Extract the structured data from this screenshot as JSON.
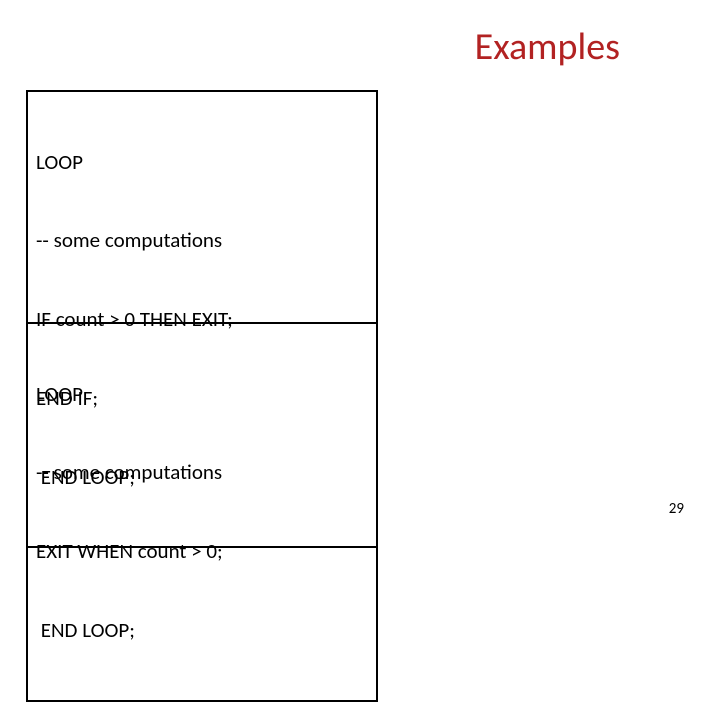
{
  "title": "Examples",
  "box1": {
    "l1": "LOOP",
    "l2": "-- some computations",
    "l3": "IF count > 0 THEN EXIT;",
    "l4": "END IF;",
    "l5": " END LOOP;"
  },
  "box2": {
    "l1": "LOOP",
    "l2": "-- some computations",
    "l3": "EXIT WHEN count > 0;",
    "l4": " END LOOP;"
  },
  "page_number": "29"
}
